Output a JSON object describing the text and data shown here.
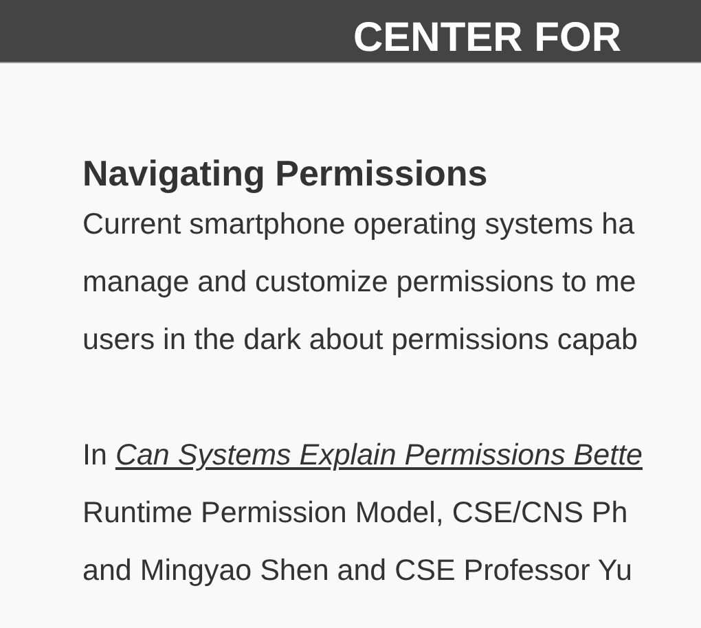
{
  "header": {
    "title": "CENTER FOR"
  },
  "article": {
    "heading": "Navigating Permissions",
    "paragraphs": [
      {
        "lines": [
          {
            "parts": [
              {
                "kind": "text",
                "text": "Current smartphone operating systems ha"
              }
            ]
          },
          {
            "parts": [
              {
                "kind": "text",
                "text": "manage and customize permissions to me"
              }
            ]
          },
          {
            "parts": [
              {
                "kind": "text",
                "text": "users in the dark about permissions capab"
              }
            ]
          }
        ]
      },
      {
        "lines": [
          {
            "parts": [
              {
                "kind": "text",
                "text": "In"
              },
              {
                "kind": "link",
                "text": "Can Systems Explain Permissions Bette"
              }
            ]
          },
          {
            "parts": [
              {
                "kind": "text",
                "text": "Runtime Permission Model, CSE/CNS Ph"
              }
            ]
          },
          {
            "parts": [
              {
                "kind": "text",
                "text": "and Mingyao Shen and CSE Professor Yu"
              }
            ]
          }
        ]
      }
    ]
  }
}
